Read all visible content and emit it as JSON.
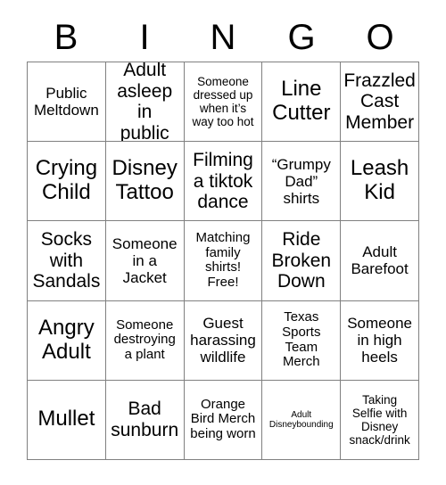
{
  "card": {
    "header_letters": [
      "B",
      "I",
      "N",
      "G",
      "O"
    ],
    "rows": [
      [
        {
          "text": "Public\nMeltdown",
          "size": "md"
        },
        {
          "text": "Adult\nasleep in\npublic",
          "size": "lg"
        },
        {
          "text": "Someone\ndressed up\nwhen it’s\nway too hot",
          "size": "xs"
        },
        {
          "text": "Line\nCutter",
          "size": "xl"
        },
        {
          "text": "Frazzled\nCast\nMember",
          "size": "lg"
        }
      ],
      [
        {
          "text": "Crying\nChild",
          "size": "xl"
        },
        {
          "text": "Disney\nTattoo",
          "size": "xl"
        },
        {
          "text": "Filming\na tiktok\ndance",
          "size": "lg"
        },
        {
          "text": "“Grumpy\nDad”\nshirts",
          "size": "md"
        },
        {
          "text": "Leash\nKid",
          "size": "xl"
        }
      ],
      [
        {
          "text": "Socks\nwith\nSandals",
          "size": "lg"
        },
        {
          "text": "Someone\nin a\nJacket",
          "size": "md"
        },
        {
          "text": "Matching\nfamily\nshirts!\nFree!",
          "size": "sm"
        },
        {
          "text": "Ride\nBroken\nDown",
          "size": "lg"
        },
        {
          "text": "Adult\nBarefoot",
          "size": "md"
        }
      ],
      [
        {
          "text": "Angry\nAdult",
          "size": "xl"
        },
        {
          "text": "Someone\ndestroying\na plant",
          "size": "sm"
        },
        {
          "text": "Guest\nharassing\nwildlife",
          "size": "md"
        },
        {
          "text": "Texas\nSports\nTeam\nMerch",
          "size": "sm"
        },
        {
          "text": "Someone\nin high\nheels",
          "size": "md"
        }
      ],
      [
        {
          "text": "Mullet",
          "size": "xl"
        },
        {
          "text": "Bad\nsunburn",
          "size": "lg"
        },
        {
          "text": "Orange\nBird Merch\nbeing worn",
          "size": "sm"
        },
        {
          "text": "Adult\nDisneybounding",
          "size": "xxs"
        },
        {
          "text": "Taking\nSelfie with\nDisney\nsnack/drink",
          "size": "xs"
        }
      ]
    ]
  }
}
